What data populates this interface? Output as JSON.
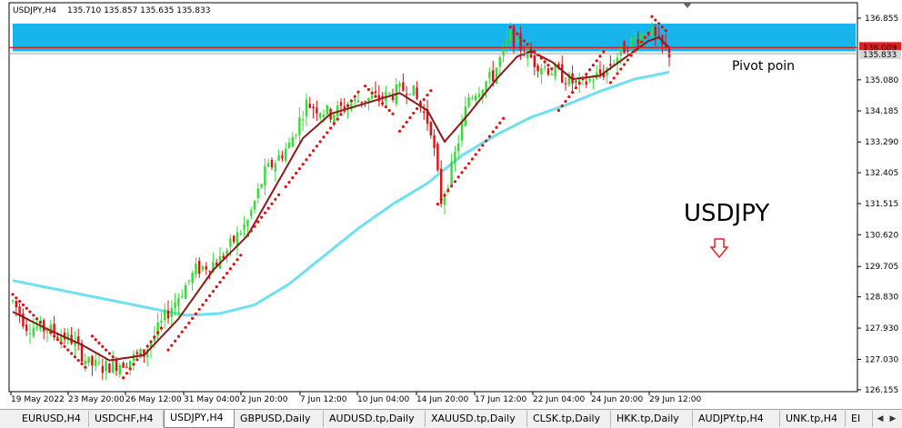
{
  "header": {
    "symbol_timeframe": "USDJPY,H4",
    "ohlc": "135.710 135.857 135.635 135.833"
  },
  "annotations": {
    "pivot_label": "Pivot poin",
    "symbol_label": "USDJPY",
    "arrow_icon": "down-arrow-icon",
    "arrow_color": "#e8201a"
  },
  "price_tags": {
    "pivot_price": "136.009",
    "current_price": "135.833"
  },
  "colors": {
    "zone": "#18b4ec",
    "pivot_line": "#e02020",
    "current_line": "#a0a0a0",
    "bull_candle": "#33dd33",
    "bear_candle": "#dd1111",
    "sar_dots": "#dd1111",
    "fast_ma": "#8b1a1a",
    "slow_ma": "#6fe0f0"
  },
  "tabs": [
    {
      "label": "EURUSD,H4",
      "active": false
    },
    {
      "label": "USDCHF,H4",
      "active": false
    },
    {
      "label": "USDJPY,H4",
      "active": true
    },
    {
      "label": "GBPUSD,Daily",
      "active": false
    },
    {
      "label": "AUDUSD.tp,Daily",
      "active": false
    },
    {
      "label": "XAUUSD.tp,Daily",
      "active": false
    },
    {
      "label": "CLSK.tp,Daily",
      "active": false
    },
    {
      "label": "HKK.tp,Daily",
      "active": false
    },
    {
      "label": "AUDJPY.tp,H4",
      "active": false
    },
    {
      "label": "UNK.tp,H4",
      "active": false
    },
    {
      "label": "EI",
      "active": false
    }
  ],
  "chart_data": {
    "type": "candlestick",
    "ylim": [
      126.1,
      137.3
    ],
    "y_ticks": [
      "136.855",
      "136.009",
      "135.833",
      "135.080",
      "134.185",
      "133.290",
      "132.405",
      "131.515",
      "130.620",
      "129.705",
      "128.830",
      "127.930",
      "127.030",
      "126.155"
    ],
    "x_ticks": [
      "19 May 2022",
      "23 May 20:00",
      "26 May 12:00",
      "31 May 04:00",
      "2 Jun 20:00",
      "7 Jun 12:00",
      "10 Jun 04:00",
      "14 Jun 20:00",
      "17 Jun 12:00",
      "22 Jun 04:00",
      "24 Jun 20:00",
      "29 Jun 12:00"
    ],
    "resistance_zone": [
      135.9,
      136.7
    ],
    "pivot_level": 136.009,
    "current_price": 135.833,
    "close_path": [
      [
        0,
        128.7
      ],
      [
        4,
        128.0
      ],
      [
        10,
        127.9
      ],
      [
        17,
        127.6
      ],
      [
        22,
        126.9
      ],
      [
        26,
        126.8
      ],
      [
        32,
        126.95
      ],
      [
        38,
        127.2
      ],
      [
        45,
        128.4
      ],
      [
        53,
        129.6
      ],
      [
        60,
        129.9
      ],
      [
        68,
        131.0
      ],
      [
        73,
        132.4
      ],
      [
        80,
        133.2
      ],
      [
        85,
        134.4
      ],
      [
        92,
        134.1
      ],
      [
        100,
        134.5
      ],
      [
        108,
        134.6
      ],
      [
        115,
        134.9
      ],
      [
        121,
        133.7
      ],
      [
        124,
        131.6
      ],
      [
        127,
        132.5
      ],
      [
        132,
        134.6
      ],
      [
        139,
        135.2
      ],
      [
        144,
        136.35
      ],
      [
        151,
        135.6
      ],
      [
        157,
        135.3
      ],
      [
        164,
        134.9
      ],
      [
        171,
        135.3
      ],
      [
        178,
        136.1
      ],
      [
        184,
        136.55
      ],
      [
        187,
        136.1
      ],
      [
        190,
        135.85
      ]
    ],
    "ma_fast": [
      [
        0,
        128.4
      ],
      [
        10,
        127.9
      ],
      [
        20,
        127.45
      ],
      [
        28,
        127.0
      ],
      [
        38,
        127.15
      ],
      [
        48,
        128.2
      ],
      [
        58,
        129.6
      ],
      [
        68,
        130.6
      ],
      [
        76,
        132.0
      ],
      [
        84,
        133.4
      ],
      [
        92,
        134.1
      ],
      [
        102,
        134.4
      ],
      [
        112,
        134.7
      ],
      [
        120,
        134.2
      ],
      [
        125,
        133.3
      ],
      [
        132,
        134.1
      ],
      [
        140,
        135.1
      ],
      [
        146,
        135.75
      ],
      [
        150,
        135.9
      ],
      [
        156,
        135.6
      ],
      [
        162,
        135.1
      ],
      [
        170,
        135.2
      ],
      [
        177,
        135.7
      ],
      [
        184,
        136.2
      ],
      [
        187,
        136.3
      ],
      [
        190,
        136.0
      ]
    ],
    "ma_slow": [
      [
        0,
        129.3
      ],
      [
        20,
        128.9
      ],
      [
        40,
        128.5
      ],
      [
        50,
        128.3
      ],
      [
        60,
        128.35
      ],
      [
        70,
        128.6
      ],
      [
        80,
        129.2
      ],
      [
        90,
        130.0
      ],
      [
        100,
        130.8
      ],
      [
        110,
        131.5
      ],
      [
        120,
        132.1
      ],
      [
        130,
        132.9
      ],
      [
        140,
        133.5
      ],
      [
        150,
        134.0
      ],
      [
        160,
        134.35
      ],
      [
        170,
        134.75
      ],
      [
        180,
        135.1
      ],
      [
        190,
        135.3
      ]
    ],
    "sar": [
      [
        0,
        128.9,
        22
      ],
      [
        23,
        127.7,
        8
      ],
      [
        32,
        126.5,
        12
      ],
      [
        45,
        127.3,
        22
      ],
      [
        68,
        130.6,
        10
      ],
      [
        79,
        132.0,
        22
      ],
      [
        102,
        134.9,
        9
      ],
      [
        112,
        133.6,
        10
      ],
      [
        123,
        131.5,
        20
      ],
      [
        144,
        136.6,
        13
      ],
      [
        158,
        134.2,
        14
      ],
      [
        173,
        135.0,
        12
      ],
      [
        185,
        136.9,
        5
      ]
    ]
  }
}
